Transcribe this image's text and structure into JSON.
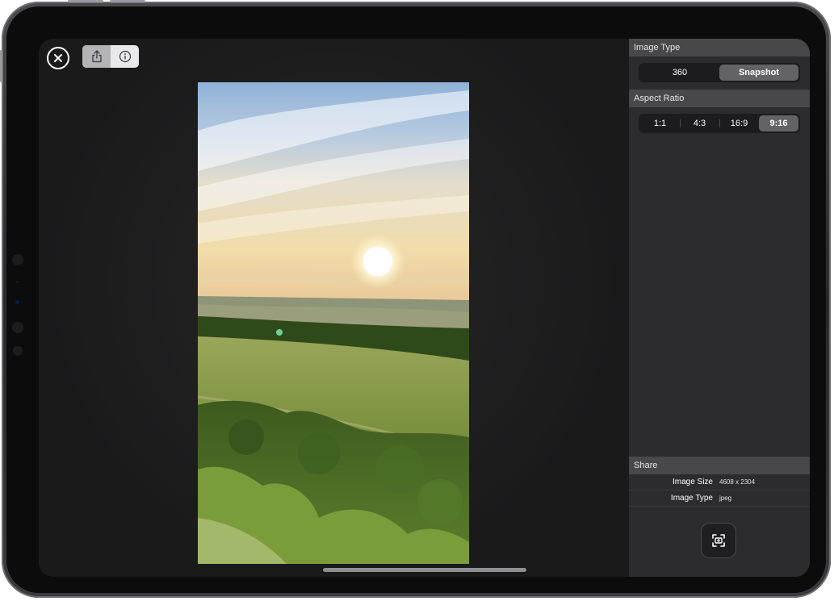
{
  "toolbar": {
    "close_icon": "close-circle-icon",
    "share_icon": "share-icon",
    "info_icon": "info-icon"
  },
  "image_type": {
    "header": "Image Type",
    "options": [
      "360",
      "Snapshot"
    ],
    "selected": "Snapshot"
  },
  "aspect_ratio": {
    "header": "Aspect Ratio",
    "options": [
      "1:1",
      "4:3",
      "16:9",
      "9:16"
    ],
    "selected": "9:16"
  },
  "share": {
    "header": "Share",
    "rows": [
      {
        "key": "Image Size",
        "value": "4608 x 2304"
      },
      {
        "key": "Image Type",
        "value": "jpeg"
      }
    ],
    "capture_icon": "capture-icon"
  },
  "colors": {
    "panel_bg": "#2c2c2e",
    "header_bg": "#48484b",
    "selected_segment": "#636366"
  }
}
